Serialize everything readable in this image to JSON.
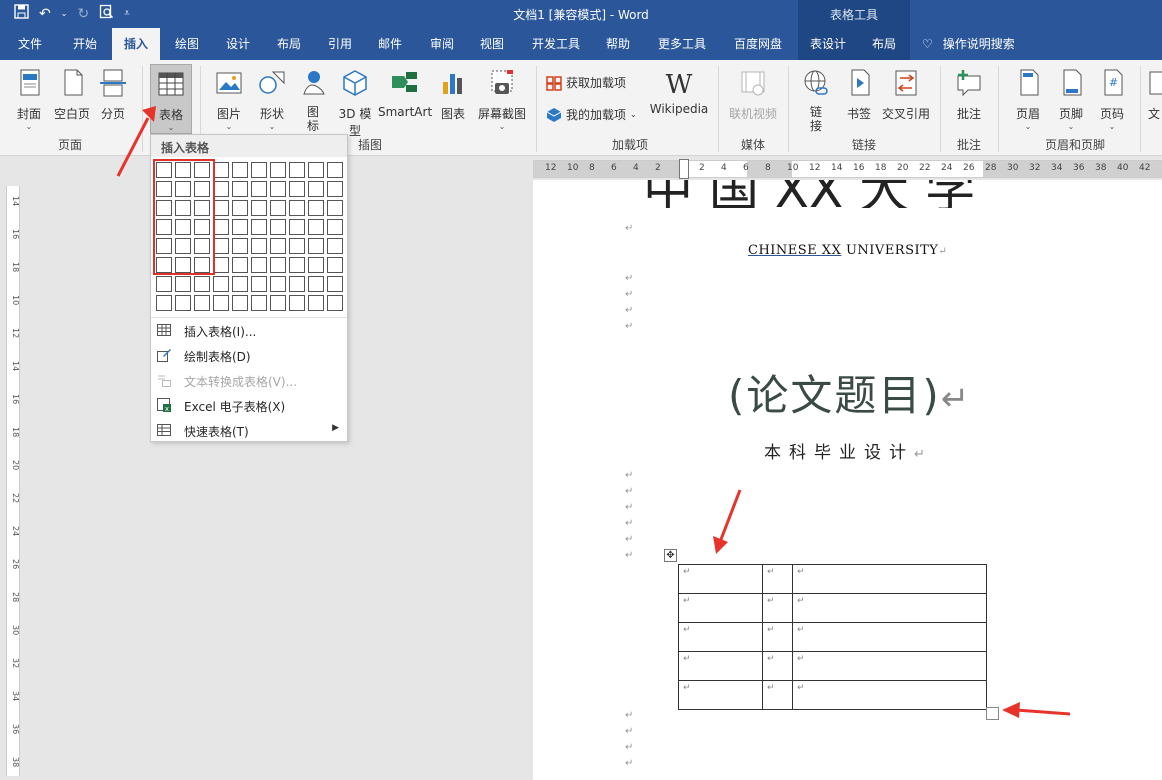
{
  "title_bar": {
    "doc_title": "文档1 [兼容模式] - Word",
    "context_group": "表格工具"
  },
  "tabs": [
    "文件",
    "开始",
    "插入",
    "绘图",
    "设计",
    "布局",
    "引用",
    "邮件",
    "审阅",
    "视图",
    "开发工具",
    "帮助",
    "更多工具",
    "百度网盘",
    "表设计",
    "布局"
  ],
  "active_tab": "插入",
  "tell_me": "操作说明搜索",
  "ribbon": {
    "pages": {
      "cover": "封面",
      "blank": "空白页",
      "break": "分页",
      "label": "页面"
    },
    "table": {
      "label": "表格"
    },
    "illustrations": {
      "picture": "图片",
      "shapes": "形状",
      "icons": "图标",
      "model3d": "3D 模型",
      "smartart": "SmartArt",
      "chart": "图表",
      "screenshot": "屏幕截图",
      "label": "插图"
    },
    "addins": {
      "get": "获取加载项",
      "mine": "我的加载项",
      "wikipedia": "Wikipedia",
      "label": "加载项"
    },
    "media": {
      "online_video": "联机视频",
      "label": "媒体"
    },
    "links": {
      "link": "链接",
      "bookmark": "书签",
      "crossref": "交叉引用",
      "label": "链接"
    },
    "comments": {
      "comment": "批注",
      "label": "批注"
    },
    "header_footer": {
      "header": "页眉",
      "footer": "页脚",
      "page_number": "页码",
      "label": "页眉和页脚"
    },
    "text": {
      "partial": "文"
    }
  },
  "dropdown": {
    "header": "插入表格",
    "items": [
      {
        "label": "插入表格(I)...",
        "disabled": false
      },
      {
        "label": "绘制表格(D)",
        "disabled": false
      },
      {
        "label": "文本转换成表格(V)...",
        "disabled": true
      },
      {
        "label": "Excel 电子表格(X)",
        "disabled": false
      },
      {
        "label": "快速表格(T)",
        "disabled": false,
        "submenu": true
      }
    ]
  },
  "document": {
    "university_cut": "中 国  XX  大 学",
    "university_en_part1": "CHINESE  XX",
    "university_en_part2": "  UNIVERSITY",
    "thesis_title": "(论文题目)",
    "subtitle": "本科毕业设计",
    "para_mark": "↵",
    "table_rows": 5,
    "table_cols": 3
  },
  "hruler_numbers": [
    "12",
    "10",
    "8",
    "6",
    "4",
    "2",
    "",
    "2",
    "4",
    "6",
    "8",
    "10",
    "12",
    "14",
    "16",
    "18",
    "20",
    "22",
    "24",
    "26",
    "28",
    "30",
    "32",
    "34",
    "36",
    "38",
    "40",
    "42"
  ],
  "vruler_numbers": [
    "14",
    "16",
    "18",
    "10",
    "12",
    "14",
    "16",
    "18",
    "20",
    "22",
    "24",
    "26",
    "28",
    "30",
    "32",
    "34",
    "36",
    "38"
  ]
}
